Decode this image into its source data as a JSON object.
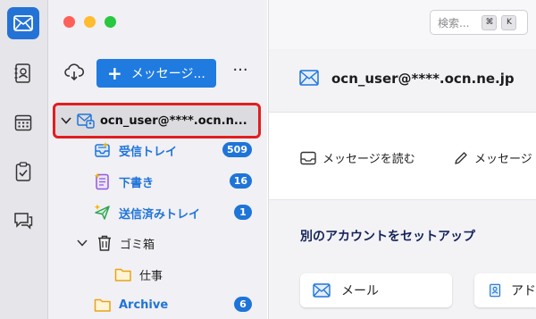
{
  "window": {
    "traffic_lights": [
      "#fe5f57",
      "#febc2e",
      "#28c840"
    ]
  },
  "spaces_toolbar": {
    "items": [
      {
        "icon": "mail-icon",
        "active": true
      },
      {
        "icon": "address-book-icon",
        "active": false
      },
      {
        "icon": "calendar-icon",
        "active": false
      },
      {
        "icon": "tasks-icon",
        "active": false
      },
      {
        "icon": "chat-icon",
        "active": false
      }
    ]
  },
  "folder_pane": {
    "new_message_label": "メッセージ...",
    "menu_label": "···",
    "account": {
      "name": "ocn_user@****.ocn.n..."
    },
    "folders": [
      {
        "name": "受信トレイ",
        "count": "509",
        "icon": "inbox-icon"
      },
      {
        "name": "下書き",
        "count": "16",
        "icon": "drafts-icon"
      },
      {
        "name": "送信済みトレイ",
        "count": "1",
        "icon": "sent-icon"
      },
      {
        "name": "ゴミ箱",
        "count": "",
        "icon": "trash-icon"
      },
      {
        "name": "仕事",
        "count": "",
        "icon": "folder-icon"
      },
      {
        "name": "Archive",
        "count": "6",
        "icon": "archive-folder-icon"
      }
    ]
  },
  "search": {
    "placeholder": "検索...",
    "shortcut_modifier": "⌘",
    "shortcut_key": "K"
  },
  "account_hub": {
    "title": "ocn_user@****.ocn.ne.jp",
    "actions": [
      {
        "label": "メッセージを読む",
        "icon": "read-mail-icon"
      },
      {
        "label": "メッセージ",
        "icon": "pencil-icon"
      }
    ],
    "setup_title": "別のアカウントをセットアップ",
    "setup_options": [
      {
        "label": "メール",
        "icon": "mail-icon"
      },
      {
        "label": "アド",
        "icon": "address-book-icon"
      }
    ]
  },
  "colors": {
    "accent": "#1f74d8",
    "highlight_border": "#e11e20"
  }
}
